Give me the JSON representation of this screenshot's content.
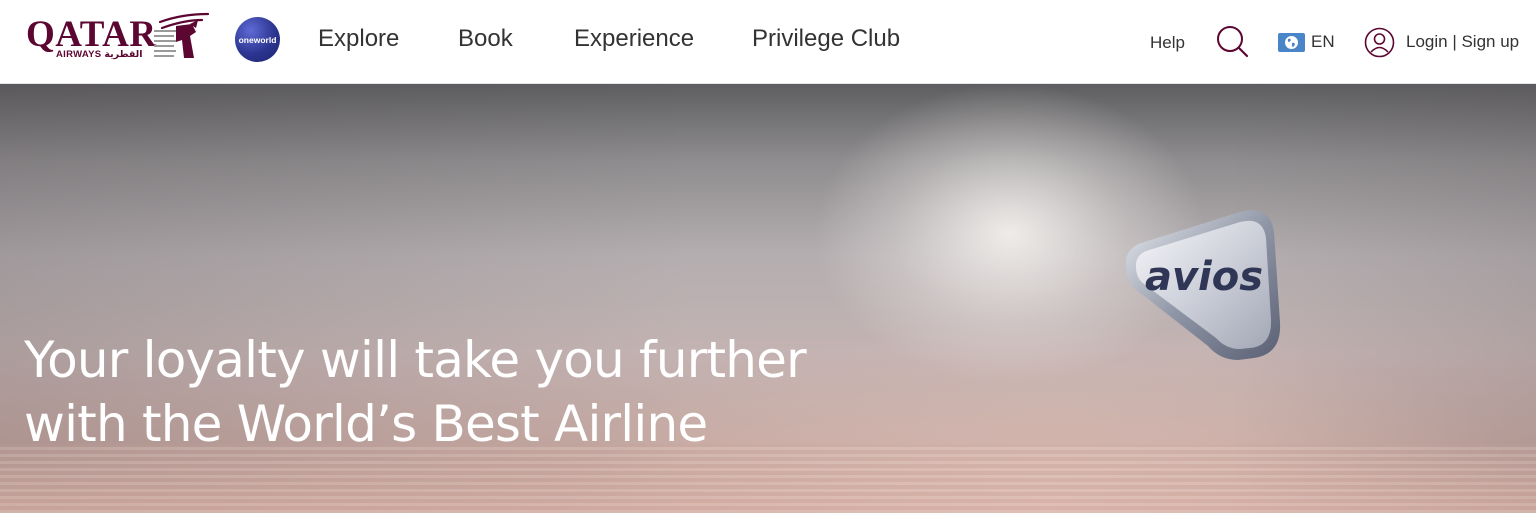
{
  "brand": {
    "logo_word": "QATAR",
    "logo_sub": "AIRWAYS القطرية",
    "alliance_label": "oneworld",
    "colors": {
      "brand": "#5c0632",
      "alliance": "#2c3590"
    }
  },
  "nav": {
    "items": [
      {
        "label": "Explore"
      },
      {
        "label": "Book"
      },
      {
        "label": "Experience"
      },
      {
        "label": "Privilege Club"
      }
    ]
  },
  "utility": {
    "help_label": "Help",
    "search_icon": "search-icon",
    "language_label": "EN",
    "language_icon": "globe-flag-icon",
    "account_icon": "user-icon",
    "login_label": "Login | Sign up"
  },
  "hero": {
    "headline_line1": "Your loyalty will take you further",
    "headline_line2": "with the World’s Best Airline",
    "badge_text": "avios"
  }
}
